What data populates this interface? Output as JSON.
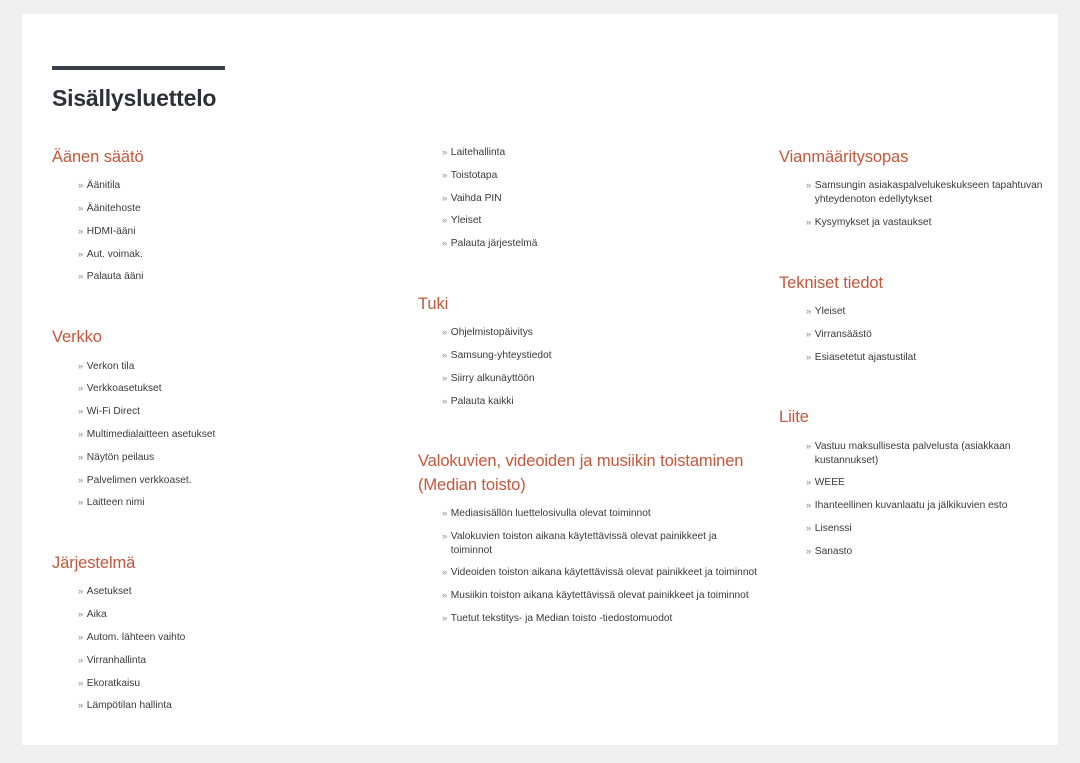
{
  "document": {
    "title": "Sisällysluettelo",
    "accent_color": "#c4573c",
    "rule_color": "#3d3d48",
    "text_color": "#3a3a3a",
    "page_background": "#ffffff",
    "canvas_background": "#efefef",
    "bullet_glyph": "»"
  },
  "columns": [
    {
      "id": "column-1",
      "sections": [
        {
          "heading": "Äänen säätö",
          "items": [
            "Äänitila",
            "Äänitehoste",
            "HDMI-ääni",
            "Aut. voimak.",
            "Palauta ääni"
          ]
        },
        {
          "heading": "Verkko",
          "items": [
            "Verkon tila",
            "Verkkoasetukset",
            "Wi-Fi Direct",
            "Multimedialaitteen asetukset",
            "Näytön peilaus",
            "Palvelimen verkkoaset.",
            "Laitteen nimi"
          ]
        },
        {
          "heading": "Järjestelmä",
          "items": [
            "Asetukset",
            "Aika",
            "Autom. lähteen vaihto",
            "Virranhallinta",
            "Ekoratkaisu",
            "Lämpötilan hallinta"
          ]
        }
      ]
    },
    {
      "id": "column-2",
      "sections": [
        {
          "heading": "",
          "items": [
            "Laitehallinta",
            "Toistotapa",
            "Vaihda PIN",
            "Yleiset",
            "Palauta järjestelmä"
          ]
        },
        {
          "heading": "Tuki",
          "items": [
            "Ohjelmistopäivitys",
            "Samsung-yhteystiedot",
            "Siirry alkunäyttöön",
            "Palauta kaikki"
          ]
        },
        {
          "heading": "Valokuvien, videoiden ja musiikin toistaminen (Median toisto)",
          "items": [
            "Mediasisällön luettelosivulla olevat toiminnot",
            "Valokuvien toiston aikana käytettävissä olevat painikkeet ja toiminnot",
            "Videoiden toiston aikana käytettävissä olevat painikkeet ja toiminnot",
            "Musiikin toiston aikana käytettävissä olevat painikkeet ja toiminnot",
            "Tuetut tekstitys- ja Median toisto -tiedostomuodot"
          ]
        }
      ]
    },
    {
      "id": "column-3",
      "sections": [
        {
          "heading": "Vianmääritysopas",
          "items": [
            "Samsungin asiakaspalvelukeskukseen tapahtuvan yhteydenoton edellytykset",
            "Kysymykset ja vastaukset"
          ]
        },
        {
          "heading": "Tekniset tiedot",
          "items": [
            "Yleiset",
            "Virransäästö",
            "Esiasetetut ajastustilat"
          ]
        },
        {
          "heading": "Liite",
          "items": [
            "Vastuu maksullisesta palvelusta (asiakkaan kustannukset)",
            "WEEE",
            "Ihanteellinen kuvanlaatu ja jälkikuvien esto",
            "Lisenssi",
            "Sanasto"
          ]
        }
      ]
    }
  ]
}
